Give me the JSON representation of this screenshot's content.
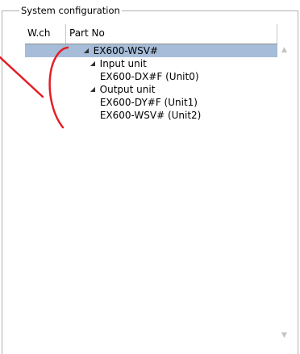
{
  "group": {
    "title": "System configuration"
  },
  "columns": {
    "wch": "W.ch",
    "part_no": "Part No"
  },
  "tree": [
    {
      "text": "EX600-WSV#",
      "expanded": true,
      "selected": true
    },
    {
      "text": "Input unit",
      "expanded": true,
      "selected": false
    },
    {
      "text": "EX600-DX#F (Unit0)",
      "expanded": null,
      "selected": false
    },
    {
      "text": "Output unit",
      "expanded": true,
      "selected": false
    },
    {
      "text": "EX600-DY#F (Unit1)",
      "expanded": null,
      "selected": false
    },
    {
      "text": "EX600-WSV# (Unit2)",
      "expanded": null,
      "selected": false
    }
  ],
  "colors": {
    "selection": "#a6bcd8",
    "annotation": "#e41e26",
    "frame": "#b0b0b0"
  },
  "icons": {
    "expand": "expanded-triangle-icon",
    "scroll_up": "scroll-up-icon",
    "scroll_down": "scroll-down-icon"
  }
}
